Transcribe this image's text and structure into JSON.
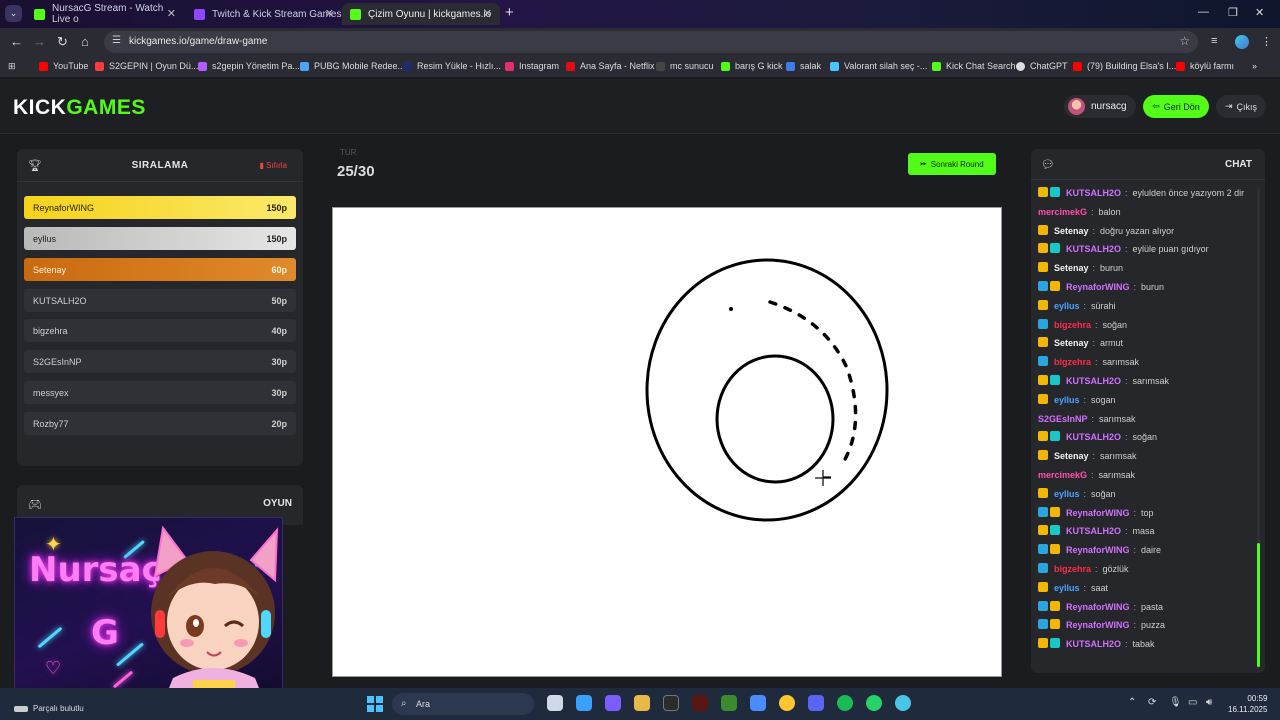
{
  "browser": {
    "tabs": [
      {
        "title": "NursacG Stream - Watch Live o",
        "color": "#53fc18",
        "active": false
      },
      {
        "title": "Twitch & Kick Stream Games",
        "color": "#9147ff",
        "active": false
      },
      {
        "title": "Çizim Oyunu | kickgames.io",
        "color": "#53fc18",
        "active": true
      }
    ],
    "url": "kickgames.io/game/draw-game",
    "bookmarks": [
      {
        "label": "YouTube",
        "color": "#ff0000"
      },
      {
        "label": "S2GEPIN | Oyun Dü...",
        "color": "#ff3b3b"
      },
      {
        "label": "s2gepin Yönetim Pa...",
        "color": "#b15cff"
      },
      {
        "label": "PUBG Mobile Redee...",
        "color": "#49a5ff"
      },
      {
        "label": "Resim Yükle - Hızlı...",
        "color": "#1e2b6e"
      },
      {
        "label": "Instagram",
        "color": "#e1306c"
      },
      {
        "label": "Ana Sayfa - Netflix",
        "color": "#e50914"
      },
      {
        "label": "mc sunucu",
        "color": "#444444"
      },
      {
        "label": "barış G kick",
        "color": "#53fc18"
      },
      {
        "label": "salak",
        "color": "#3b7de9"
      },
      {
        "label": "Valorant silah seç -...",
        "color": "#47c6ff"
      },
      {
        "label": "Kick Chat Search",
        "color": "#53fc18"
      },
      {
        "label": "ChatGPT",
        "color": "#dddddd"
      },
      {
        "label": "(79) Building Elsa's I...",
        "color": "#ff0000"
      },
      {
        "label": "köylü farmı",
        "color": "#ff0000"
      }
    ]
  },
  "header": {
    "logo_kick": "KICK",
    "logo_games": "GAMES",
    "username": "nursacg",
    "back_label": "Geri Dön",
    "logout_label": "Çıkış"
  },
  "leaderboard": {
    "title": "SIRALAMA",
    "reset_label": "Sıfırla",
    "rows": [
      {
        "name": "ReynaforWING",
        "points": "150p"
      },
      {
        "name": "eyllus",
        "points": "150p"
      },
      {
        "name": "Setenay",
        "points": "60p"
      },
      {
        "name": "KUTSALH2O",
        "points": "50p"
      },
      {
        "name": "bigzehra",
        "points": "40p"
      },
      {
        "name": "S2GEsInNP",
        "points": "30p"
      },
      {
        "name": "messyex",
        "points": "30p"
      },
      {
        "name": "Rozby77",
        "points": "20p"
      }
    ]
  },
  "game_panel": {
    "title": "OYUN"
  },
  "overlay": {
    "line1": "Nursaç",
    "line2": "G"
  },
  "round": {
    "label": "TUR",
    "count": "25/30",
    "next_label": "Sonraki Round"
  },
  "chat": {
    "title": "CHAT",
    "messages": [
      {
        "user": "KUTSALH2O",
        "color": "#d070ff",
        "badges": [
          "crown",
          "sub"
        ],
        "text": "eylulden önce yazıyom 2 dir"
      },
      {
        "user": "mercimekG",
        "color": "#ff4fb0",
        "badges": [],
        "text": "balon"
      },
      {
        "user": "Setenay",
        "color": "#f2f2f2",
        "badges": [
          "crown"
        ],
        "text": "doğru yazan alıyor"
      },
      {
        "user": "KUTSALH2O",
        "color": "#d070ff",
        "badges": [
          "crown",
          "sub"
        ],
        "text": "eylüle puan gıdıyor"
      },
      {
        "user": "Setenay",
        "color": "#f2f2f2",
        "badges": [
          "crown"
        ],
        "text": "burun"
      },
      {
        "user": "ReynaforWING",
        "color": "#d070ff",
        "badges": [
          "share",
          "crown"
        ],
        "text": "burun"
      },
      {
        "user": "eyllus",
        "color": "#4aa3ff",
        "badges": [
          "crown"
        ],
        "text": "sürahi"
      },
      {
        "user": "bigzehra",
        "color": "#ff2a4a",
        "badges": [
          "share"
        ],
        "text": "soğan"
      },
      {
        "user": "Setenay",
        "color": "#f2f2f2",
        "badges": [
          "crown"
        ],
        "text": "armut"
      },
      {
        "user": "bigzehra",
        "color": "#ff2a4a",
        "badges": [
          "share"
        ],
        "text": "sarımsak"
      },
      {
        "user": "KUTSALH2O",
        "color": "#d070ff",
        "badges": [
          "crown",
          "sub"
        ],
        "text": "sarımsak"
      },
      {
        "user": "eyllus",
        "color": "#4aa3ff",
        "badges": [
          "crown"
        ],
        "text": "sogan"
      },
      {
        "user": "S2GEsInNP",
        "color": "#d070ff",
        "badges": [],
        "text": "sarımsak"
      },
      {
        "user": "KUTSALH2O",
        "color": "#d070ff",
        "badges": [
          "crown",
          "sub"
        ],
        "text": "soğan"
      },
      {
        "user": "Setenay",
        "color": "#f2f2f2",
        "badges": [
          "crown"
        ],
        "text": "sarımsak"
      },
      {
        "user": "mercimekG",
        "color": "#ff4fb0",
        "badges": [],
        "text": "sarımsak"
      },
      {
        "user": "eyllus",
        "color": "#4aa3ff",
        "badges": [
          "crown"
        ],
        "text": "soğan"
      },
      {
        "user": "ReynaforWING",
        "color": "#d070ff",
        "badges": [
          "share",
          "crown"
        ],
        "text": "top"
      },
      {
        "user": "KUTSALH2O",
        "color": "#d070ff",
        "badges": [
          "crown",
          "sub"
        ],
        "text": "masa"
      },
      {
        "user": "ReynaforWING",
        "color": "#d070ff",
        "badges": [
          "share",
          "crown"
        ],
        "text": "daire"
      },
      {
        "user": "bigzehra",
        "color": "#ff2a4a",
        "badges": [
          "share"
        ],
        "text": "gözlük"
      },
      {
        "user": "eyllus",
        "color": "#4aa3ff",
        "badges": [
          "crown"
        ],
        "text": "saat"
      },
      {
        "user": "ReynaforWING",
        "color": "#d070ff",
        "badges": [
          "share",
          "crown"
        ],
        "text": "pasta"
      },
      {
        "user": "ReynaforWING",
        "color": "#d070ff",
        "badges": [
          "share",
          "crown"
        ],
        "text": "puzza"
      },
      {
        "user": "KUTSALH2O",
        "color": "#d070ff",
        "badges": [
          "crown",
          "sub"
        ],
        "text": "tabak"
      }
    ]
  },
  "taskbar": {
    "notification": "Parçalı bulutlu",
    "search_label": "Ara",
    "time": "00:59",
    "date": "16.11.2025"
  },
  "colors": {
    "accent": "#53fc18",
    "danger": "#ef4444",
    "panel": "#26272b",
    "page_bg": "#1b1c1f"
  }
}
